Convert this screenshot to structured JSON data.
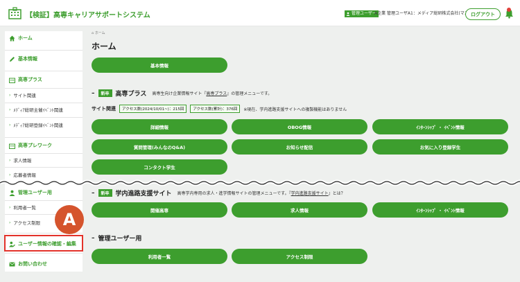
{
  "header": {
    "title": "【検証】高専キャリアサポートシステム",
    "user_badge": "管理ユーザー",
    "user_info": "A企業 管理ユーザA1：メディア総研株式会社(マスタ)",
    "logout": "ログアウト"
  },
  "sidebar": {
    "home": "ホーム",
    "basic": "基本情報",
    "kosen_plus": "高専プラス",
    "site_related": "サイト関連",
    "media_host": "ﾒﾃﾞｨｱ総研主催ｲﾍﾞﾝﾄ関連",
    "media_reg": "ﾒﾃﾞｨｱ総研登録ｲﾍﾞﾝﾄ関連",
    "prework": "高専プレワーク",
    "job_info": "求人情報",
    "applicant": "応募者情報",
    "admin_users": "管理ユーザー用",
    "user_list": "利用者一覧",
    "access_limit": "アクセス制限",
    "user_edit": "ユーザー情報の確認・編集",
    "contact": "お問い合わせ"
  },
  "main": {
    "breadcrumb": "ホーム",
    "title": "ホーム",
    "basic_btn": "基本情報",
    "sec1": {
      "tag": "新卒",
      "title": "高専プラス",
      "desc_pre": "高専生向け企業情報サイト『",
      "desc_link": "高専プラス",
      "desc_post": "』の管理メニューです。"
    },
    "stats": {
      "label": "サイト関連",
      "box1": "アクセス数(2024/10/01~)：215回",
      "box2": "アクセス数(累計)：376回",
      "note": "※現在、学内進路支援サイトへの複製機能はありません"
    },
    "sec1_buttons": [
      "詳細情報",
      "OBOG情報",
      "ｲﾝﾀｰﾝｼｯﾌﾟ ・ ｲﾍﾞﾝﾄ情報",
      "質問管理(みんなのQ&A)",
      "お知らせ配信",
      "お気に入り登録学生",
      "コンタクト学生"
    ],
    "sec2": {
      "tag": "新卒",
      "title": "学内進路支援サイト",
      "desc_pre": "高専学内専用の求人・進学情報サイトの管理メニューです。『",
      "desc_link": "学内進路支援サイト",
      "desc_post": "』とは？"
    },
    "sec2_buttons": [
      "開催高専",
      "求人情報",
      "ｲﾝﾀｰﾝｼｯﾌﾟ ・ ｲﾍﾞﾝﾄ情報"
    ],
    "sec3": {
      "title": "管理ユーザー用"
    },
    "sec3_buttons": [
      "利用者一覧",
      "アクセス制限"
    ]
  },
  "annotation": {
    "badge": "A"
  },
  "colors": {
    "accent": "#3d9e2e",
    "highlight": "#e3322a",
    "badge": "#d5542d"
  }
}
